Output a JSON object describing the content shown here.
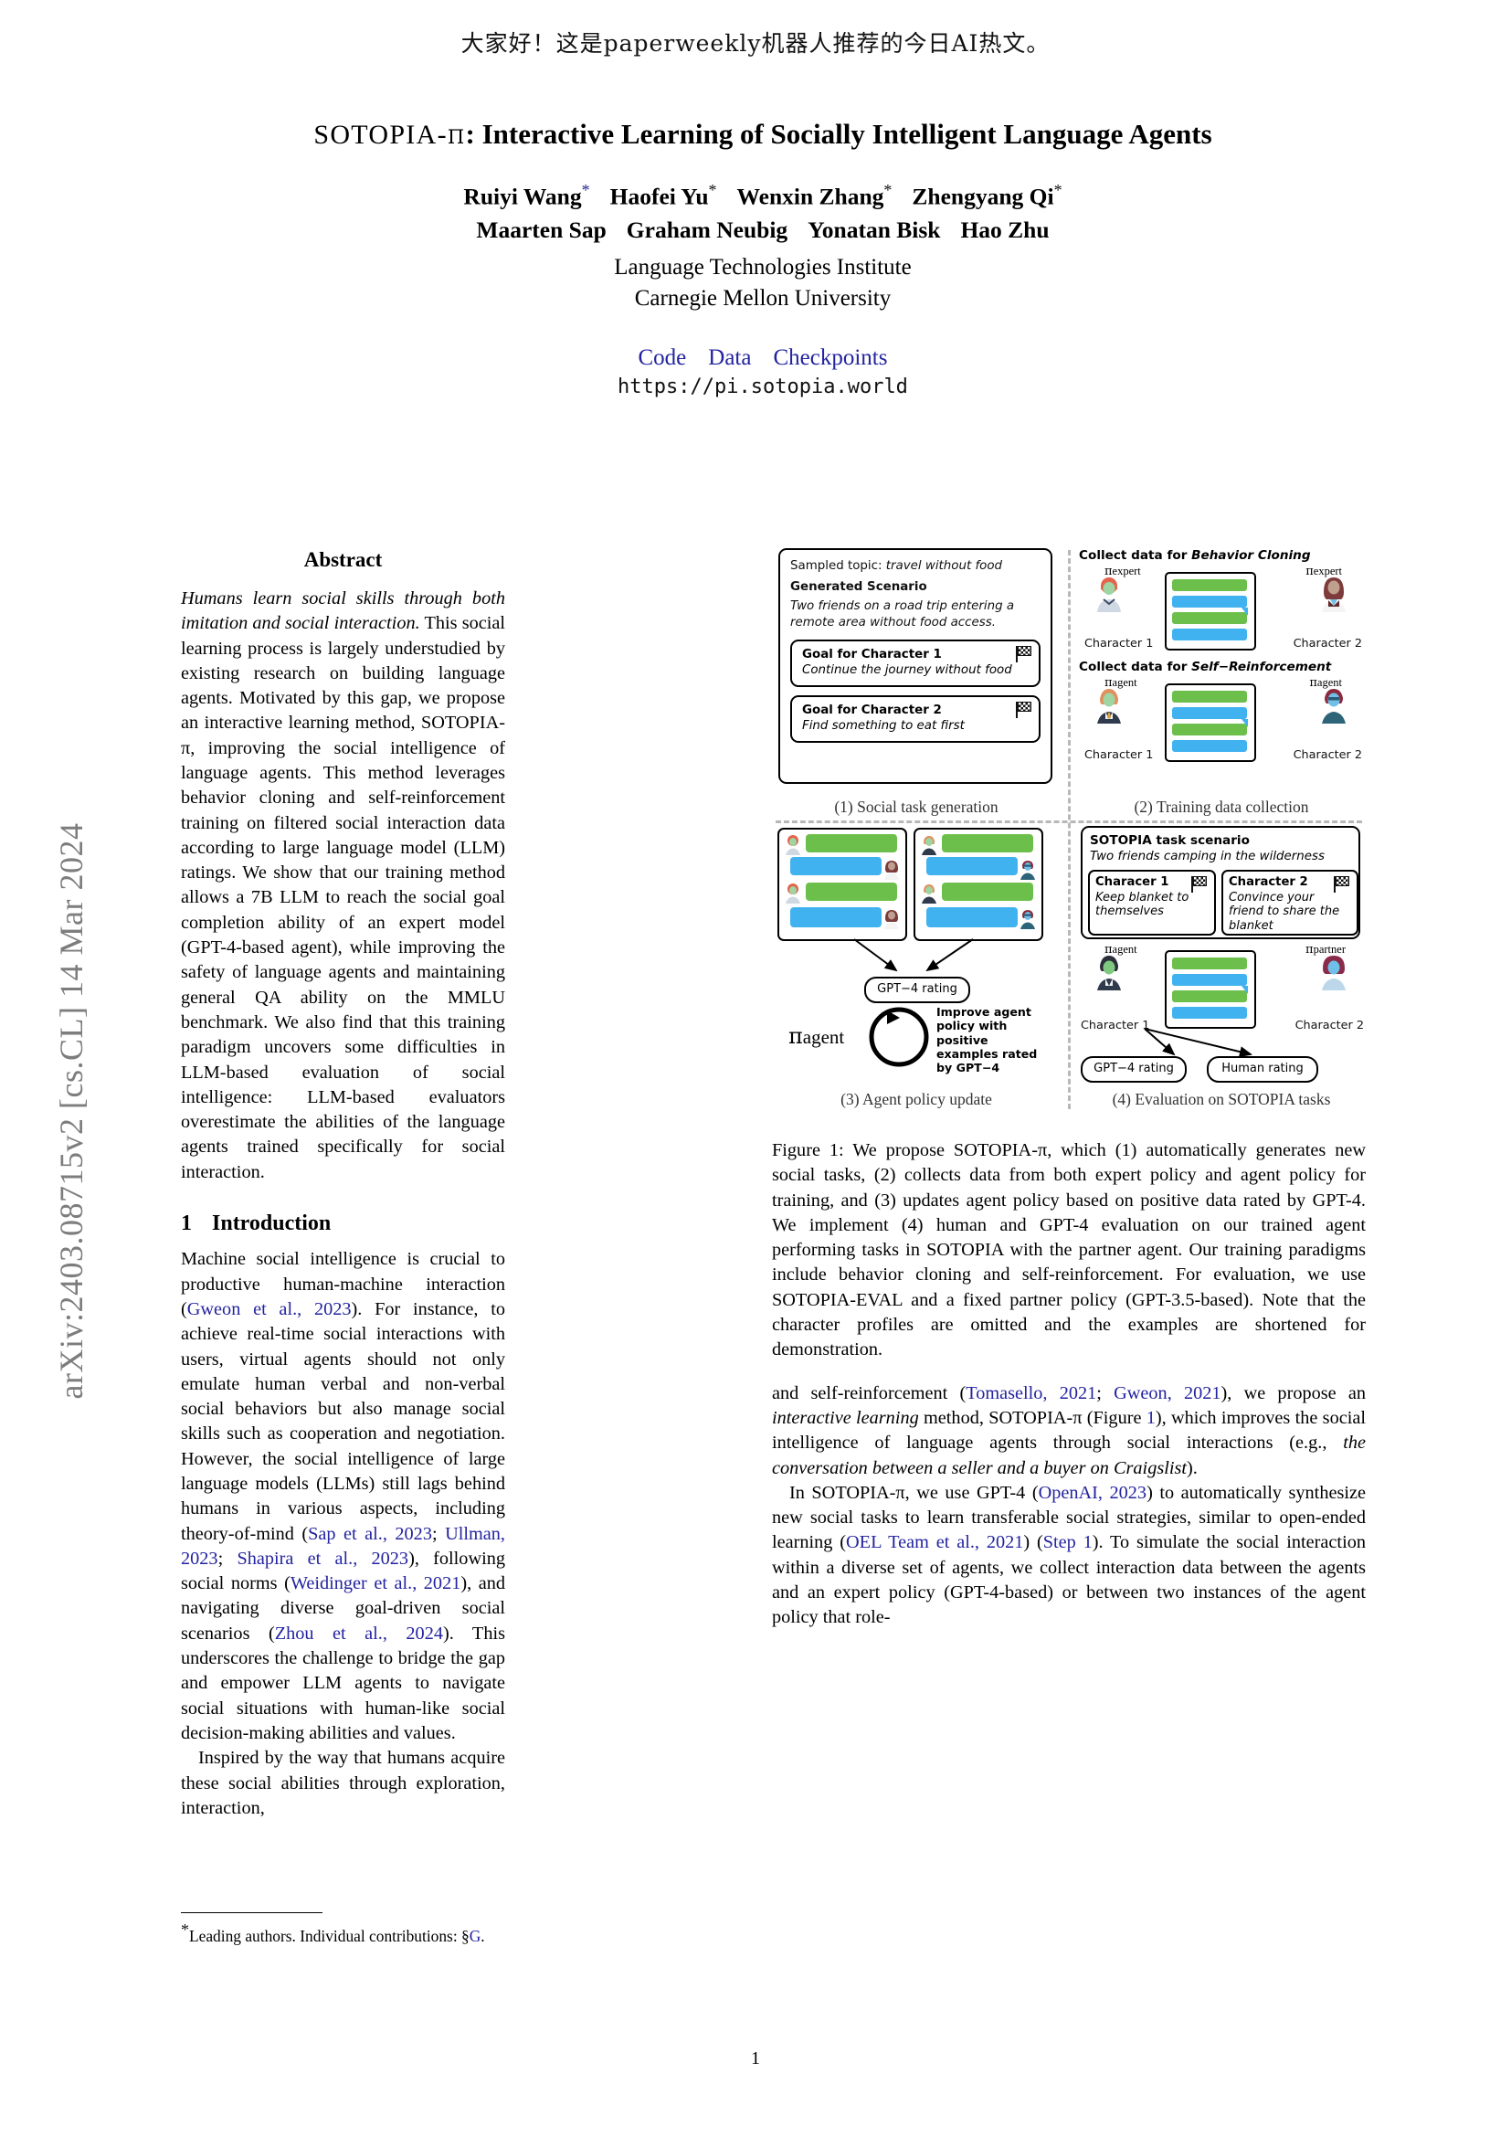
{
  "banner": {
    "text": "大家好！这是paperweekly机器人推荐的今日AI热文。"
  },
  "arxiv": {
    "stamp": "arXiv:2403.08715v2  [cs.CL]  14 Mar 2024"
  },
  "title": {
    "smallcaps": "SOTOPIA",
    "pi": "π",
    "rest": ": Interactive Learning of Socially Intelligent Language Agents"
  },
  "authors": {
    "row1": [
      {
        "name": "Ruiyi Wang",
        "star": "*"
      },
      {
        "name": "Haofei Yu",
        "star": "*"
      },
      {
        "name": "Wenxin Zhang",
        "star": "*"
      },
      {
        "name": "Zhengyang Qi",
        "star": "*"
      }
    ],
    "row2": [
      {
        "name": "Maarten Sap",
        "star": ""
      },
      {
        "name": "Graham Neubig",
        "star": ""
      },
      {
        "name": "Yonatan Bisk",
        "star": ""
      },
      {
        "name": "Hao Zhu",
        "star": ""
      }
    ],
    "affiliation_line1": "Language Technologies Institute",
    "affiliation_line2": "Carnegie Mellon University"
  },
  "links": {
    "code": "Code",
    "data": "Data",
    "checkpoints": "Checkpoints",
    "url": "https://pi.sotopia.world",
    "color": "#2323a0"
  },
  "abstract": {
    "heading": "Abstract",
    "italic_lead": "Humans learn social skills through both imitation and social interaction.",
    "body": " This social learning process is largely understudied by existing research on building language agents. Motivated by this gap, we propose an interactive learning method, SOTOPIA-π, improving the social intelligence of language agents. This method leverages behavior cloning and self-reinforcement training on filtered social interaction data according to large language model (LLM) ratings. We show that our training method allows a 7B LLM to reach the social goal completion ability of an expert model (GPT-4-based agent), while improving the safety of language agents and maintaining general QA ability on the MMLU benchmark. We also find that this training paradigm uncovers some difficulties in LLM-based evaluation of social intelligence: LLM-based evaluators overestimate the abilities of the language agents trained specifically for social interaction."
  },
  "section1": {
    "number": "1",
    "heading": "Introduction",
    "para1_a": "Machine social intelligence is crucial to productive human-machine interaction (",
    "para1_cite1": "Gweon et al., 2023",
    "para1_b": "). For instance, to achieve real-time social interactions with users, virtual agents should not only emulate human verbal and non-verbal social behaviors but also manage social skills such as cooperation and negotiation. However, the social intelligence of large language models (LLMs) still lags behind humans in various aspects, including theory-of-mind (",
    "para1_cite2": "Sap et al., 2023",
    "para1_c": "; ",
    "para1_cite3": "Ullman, 2023",
    "para1_d": "; ",
    "para1_cite4": "Shapira et al., 2023",
    "para1_e": "), following social norms (",
    "para1_cite5": "Weidinger et al., 2021",
    "para1_f": "), and navigating diverse goal-driven social scenarios (",
    "para1_cite6": "Zhou et al., 2024",
    "para1_g": "). This underscores the challenge to bridge the gap and empower LLM agents to navigate social situations with human-like social decision-making abilities and values.",
    "para2": "Inspired by the way that humans acquire these social abilities through exploration, interaction,"
  },
  "footnote": {
    "text_a": "*",
    "text_b": "Leading authors. Individual contributions: §",
    "ref": "G",
    "text_c": "."
  },
  "figure": {
    "panel1": {
      "caption": "(1) Social task generation",
      "sampled_topic_label": "Sampled topic: ",
      "sampled_topic_value": "travel without food",
      "generated_scenario_label": "Generated Scenario",
      "scenario_text": "Two friends on a road trip entering a remote area without food access.",
      "goal1_title": "Goal for Character 1",
      "goal1_text": "Continue the journey without food",
      "goal2_title": "Goal for Character 2",
      "goal2_text": "Find something to eat first"
    },
    "panel2": {
      "caption": "(2) Training data collection",
      "head1_a": "Collect data for ",
      "head1_b": "Behavior Cloning",
      "head2_a": "Collect data for ",
      "head2_b": "Self−Reinforcement",
      "policy_expert": "expert",
      "policy_agent": "agent",
      "char1": "Character 1",
      "char2": "Character 2"
    },
    "panel3": {
      "caption": "(3) Agent policy update",
      "rating_pill": "GPT−4 rating",
      "improve_text": "Improve agent policy with positive examples rated by GPT−4",
      "pi_label": "agent"
    },
    "panel4": {
      "caption": "(4) Evaluation on SOTOPIA tasks",
      "scenario_title": "SOTOPIA task scenario",
      "scenario_sub": "Two friends camping in the wilderness",
      "char1_name": "Characer 1",
      "char1_goal": "Keep blanket to themselves",
      "char2_name": "Character 2",
      "char2_goal": "Convince your friend to share the blanket",
      "pi_agent": "agent",
      "pi_partner": "partner",
      "char1": "Character 1",
      "char2": "Character 2",
      "gpt_rating": "GPT−4 rating",
      "human_rating": "Human rating"
    },
    "colors": {
      "bubble_green": "#6cbf4b",
      "bubble_blue": "#3fb2ef",
      "divider": "#b8b8b8"
    }
  },
  "figure_caption": {
    "label": "Figure 1: ",
    "text_a": "We propose SOTOPIA-π, which (1) automatically generates new social tasks, (2) collects data from both expert policy and agent policy for training, and (3) updates agent policy based on positive data rated by GPT-4. We implement (4) human and GPT-4 evaluation on our trained agent performing tasks in SOTOPIA with the partner agent. Our training paradigms include behavior cloning and self-reinforcement. For evaluation, we use SOTOPIA-EVAL and a fixed partner policy (GPT-3.5-based). Note that the character profiles are omitted and the examples are shortened for demonstration."
  },
  "right_column": {
    "para1_a": "and self-reinforcement (",
    "cite1": "Tomasello, 2021",
    "para1_b": "; ",
    "cite2": "Gweon, 2021",
    "para1_c": "), we propose an ",
    "para1_it": "interactive learning",
    "para1_d": " method, SOTOPIA-π (Figure ",
    "fig_ref": "1",
    "para1_e": "), which improves the social intelligence of language agents through social interactions (e.g., ",
    "para1_it2": "the conversation between a seller and a buyer on Craigslist",
    "para1_f": ").",
    "para2_a": "In SOTOPIA-π, we use GPT-4 (",
    "cite3": "OpenAI, 2023",
    "para2_b": ") to automatically synthesize new social tasks to learn transferable social strategies, similar to open-ended learning (",
    "cite4": "OEL Team et al., 2021",
    "para2_c": ") (",
    "step_ref": "Step 1",
    "para2_d": "). To simulate the social interaction within a diverse set of agents, we collect interaction data between the agents and an expert policy (GPT-4-based) or between two instances of the agent policy that role-"
  },
  "page_number": "1"
}
